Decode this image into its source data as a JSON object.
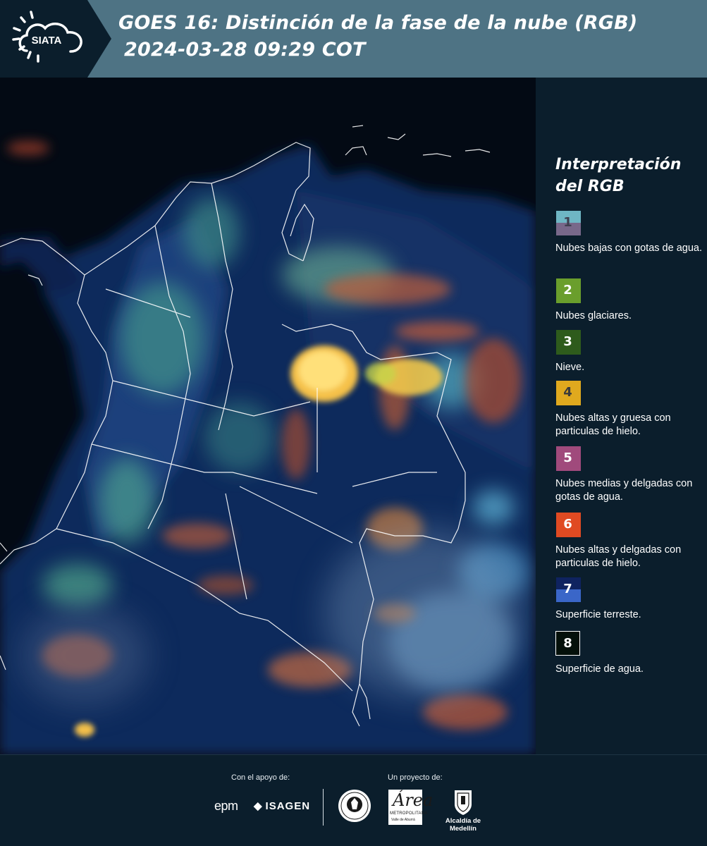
{
  "header": {
    "logo_text": "SIATA",
    "title_line1": "GOES 16: Distinción de la fase de la nube (RGB)",
    "title_line2": "2024-03-28 09:29 COT"
  },
  "legend": {
    "title": "Interpretación del RGB",
    "items": [
      {
        "number": "1",
        "label": "Nubes bajas con gotas de agua.",
        "color_top": "#6fb6c4",
        "color_bottom": "#78688a",
        "number_color": "#3f3f4f"
      },
      {
        "number": "2",
        "label": "Nubes glaciares.",
        "color_top": "#6a9e2c",
        "color_bottom": "#6a9e2c",
        "number_color": "#ffffff"
      },
      {
        "number": "3",
        "label": "Nieve.",
        "color_top": "#2e5b1c",
        "color_bottom": "#2e5b1c",
        "number_color": "#ffffff"
      },
      {
        "number": "4",
        "label": "Nubes altas y gruesa con particulas de hielo.",
        "color_top": "#e0a91e",
        "color_bottom": "#e0a91e",
        "number_color": "#3a3a3a"
      },
      {
        "number": "5",
        "label": "Nubes medias y delgadas con gotas de agua.",
        "color_top": "#a04a7c",
        "color_bottom": "#a04a7c",
        "number_color": "#ffffff"
      },
      {
        "number": "6",
        "label": "Nubes altas y delgadas con particulas de hielo.",
        "color_top": "#e04a22",
        "color_bottom": "#e04a22",
        "number_color": "#ffffff"
      },
      {
        "number": "7",
        "label": "Superficie terreste.",
        "color_top": "#0f2360",
        "color_bottom": "#3a66c8",
        "number_color": "#ffffff"
      },
      {
        "number": "8",
        "label": "Superficie de agua.",
        "color_top": "#04100a",
        "color_bottom": "#04100a",
        "number_color": "#ffffff"
      }
    ]
  },
  "footer": {
    "support_label": "Con el apoyo de:",
    "project_label": "Un proyecto de:",
    "sponsor_1": "epm",
    "sponsor_2": "ISAGEN",
    "area_logo_letter": "Área",
    "area_logo_line1": "METROPOLITANA",
    "area_logo_line2": "Valle de Aburrá",
    "alcaldia_label": "Alcaldía de Medellín"
  },
  "colors": {
    "header_bg": "#4e7384",
    "page_bg": "#0b1e2c",
    "map_bg": "#030a14",
    "border_lines": "#ffffff"
  }
}
